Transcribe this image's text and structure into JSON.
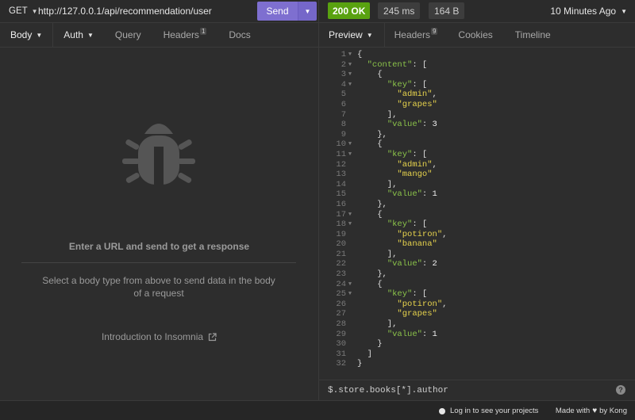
{
  "request": {
    "method": "GET",
    "url": "http://127.0.0.1/api/recommendation/user",
    "send_label": "Send"
  },
  "response_meta": {
    "status": "200 OK",
    "time": "245 ms",
    "size": "164 B",
    "history": "10 Minutes Ago"
  },
  "request_tabs": {
    "body": "Body",
    "auth": "Auth",
    "query": "Query",
    "headers": "Headers",
    "headers_count": "1",
    "docs": "Docs"
  },
  "response_tabs": {
    "preview": "Preview",
    "headers": "Headers",
    "headers_count": "9",
    "cookies": "Cookies",
    "timeline": "Timeline"
  },
  "empty_state": {
    "title": "Enter a URL and send to get a response",
    "description": "Select a body type from above to send data in the body of a request",
    "link": "Introduction to Insomnia"
  },
  "response_body": [
    {
      "n": "1",
      "fold": true,
      "t": [
        [
          "p",
          "{"
        ]
      ]
    },
    {
      "n": "2",
      "fold": true,
      "t": [
        [
          "p",
          "  "
        ],
        [
          "k",
          "\"content\""
        ],
        [
          "p",
          ": ["
        ]
      ]
    },
    {
      "n": "3",
      "fold": true,
      "t": [
        [
          "p",
          "    {"
        ]
      ]
    },
    {
      "n": "4",
      "fold": true,
      "t": [
        [
          "p",
          "      "
        ],
        [
          "k",
          "\"key\""
        ],
        [
          "p",
          ": ["
        ]
      ]
    },
    {
      "n": "5",
      "fold": false,
      "t": [
        [
          "p",
          "        "
        ],
        [
          "s",
          "\"admin\""
        ],
        [
          "p",
          ","
        ]
      ]
    },
    {
      "n": "6",
      "fold": false,
      "t": [
        [
          "p",
          "        "
        ],
        [
          "s",
          "\"grapes\""
        ]
      ]
    },
    {
      "n": "7",
      "fold": false,
      "t": [
        [
          "p",
          "      ],"
        ]
      ]
    },
    {
      "n": "8",
      "fold": false,
      "t": [
        [
          "p",
          "      "
        ],
        [
          "k",
          "\"value\""
        ],
        [
          "p",
          ": "
        ],
        [
          "n",
          "3"
        ]
      ]
    },
    {
      "n": "9",
      "fold": false,
      "t": [
        [
          "p",
          "    },"
        ]
      ]
    },
    {
      "n": "10",
      "fold": true,
      "t": [
        [
          "p",
          "    {"
        ]
      ]
    },
    {
      "n": "11",
      "fold": true,
      "t": [
        [
          "p",
          "      "
        ],
        [
          "k",
          "\"key\""
        ],
        [
          "p",
          ": ["
        ]
      ]
    },
    {
      "n": "12",
      "fold": false,
      "t": [
        [
          "p",
          "        "
        ],
        [
          "s",
          "\"admin\""
        ],
        [
          "p",
          ","
        ]
      ]
    },
    {
      "n": "13",
      "fold": false,
      "t": [
        [
          "p",
          "        "
        ],
        [
          "s",
          "\"mango\""
        ]
      ]
    },
    {
      "n": "14",
      "fold": false,
      "t": [
        [
          "p",
          "      ],"
        ]
      ]
    },
    {
      "n": "15",
      "fold": false,
      "t": [
        [
          "p",
          "      "
        ],
        [
          "k",
          "\"value\""
        ],
        [
          "p",
          ": "
        ],
        [
          "n",
          "1"
        ]
      ]
    },
    {
      "n": "16",
      "fold": false,
      "t": [
        [
          "p",
          "    },"
        ]
      ]
    },
    {
      "n": "17",
      "fold": true,
      "t": [
        [
          "p",
          "    {"
        ]
      ]
    },
    {
      "n": "18",
      "fold": true,
      "t": [
        [
          "p",
          "      "
        ],
        [
          "k",
          "\"key\""
        ],
        [
          "p",
          ": ["
        ]
      ]
    },
    {
      "n": "19",
      "fold": false,
      "t": [
        [
          "p",
          "        "
        ],
        [
          "s",
          "\"potiron\""
        ],
        [
          "p",
          ","
        ]
      ]
    },
    {
      "n": "20",
      "fold": false,
      "t": [
        [
          "p",
          "        "
        ],
        [
          "s",
          "\"banana\""
        ]
      ]
    },
    {
      "n": "21",
      "fold": false,
      "t": [
        [
          "p",
          "      ],"
        ]
      ]
    },
    {
      "n": "22",
      "fold": false,
      "t": [
        [
          "p",
          "      "
        ],
        [
          "k",
          "\"value\""
        ],
        [
          "p",
          ": "
        ],
        [
          "n",
          "2"
        ]
      ]
    },
    {
      "n": "23",
      "fold": false,
      "t": [
        [
          "p",
          "    },"
        ]
      ]
    },
    {
      "n": "24",
      "fold": true,
      "t": [
        [
          "p",
          "    {"
        ]
      ]
    },
    {
      "n": "25",
      "fold": true,
      "t": [
        [
          "p",
          "      "
        ],
        [
          "k",
          "\"key\""
        ],
        [
          "p",
          ": ["
        ]
      ]
    },
    {
      "n": "26",
      "fold": false,
      "t": [
        [
          "p",
          "        "
        ],
        [
          "s",
          "\"potiron\""
        ],
        [
          "p",
          ","
        ]
      ]
    },
    {
      "n": "27",
      "fold": false,
      "t": [
        [
          "p",
          "        "
        ],
        [
          "s",
          "\"grapes\""
        ]
      ]
    },
    {
      "n": "28",
      "fold": false,
      "t": [
        [
          "p",
          "      ],"
        ]
      ]
    },
    {
      "n": "29",
      "fold": false,
      "t": [
        [
          "p",
          "      "
        ],
        [
          "k",
          "\"value\""
        ],
        [
          "p",
          ": "
        ],
        [
          "n",
          "1"
        ]
      ]
    },
    {
      "n": "30",
      "fold": false,
      "t": [
        [
          "p",
          "    }"
        ]
      ]
    },
    {
      "n": "31",
      "fold": false,
      "t": [
        [
          "p",
          "  ]"
        ]
      ]
    },
    {
      "n": "32",
      "fold": false,
      "t": [
        [
          "p",
          "}"
        ]
      ]
    }
  ],
  "filter": {
    "placeholder": "$.store.books[*].author",
    "help": "?"
  },
  "footer": {
    "login": "Log in to see your projects",
    "made_with": "Made with",
    "by": "by Kong"
  },
  "icons": {
    "caret": "caret-down-icon",
    "empty": "bug-icon",
    "external": "external-link-icon",
    "heart": "heart-icon"
  },
  "colors": {
    "send": "#7e6fd0",
    "status_ok": "#59a210",
    "json_key": "#8bc34a",
    "json_string": "#e8d44d"
  }
}
